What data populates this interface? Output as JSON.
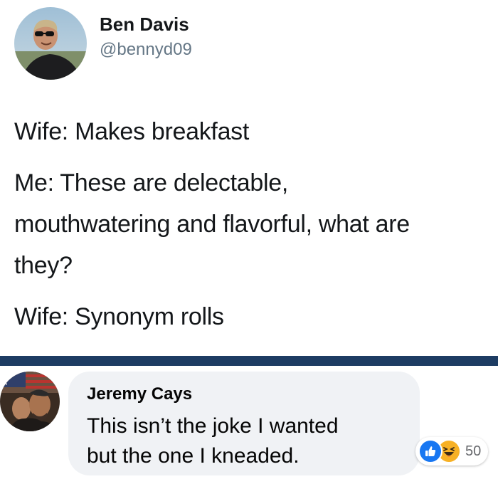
{
  "tweet": {
    "name": "Ben Davis",
    "handle": "@bennyd09",
    "lines": [
      "Wife: Makes breakfast",
      "Me: These are delectable,",
      "mouthwatering and flavorful, what are",
      "they?",
      "Wife: Synonym rolls"
    ]
  },
  "comment": {
    "author": "Jeremy Cays",
    "text_lines": [
      "This isn’t the joke I wanted",
      "but the one I kneaded."
    ],
    "reactions": {
      "icons": [
        "like-icon",
        "haha-icon"
      ],
      "count": "50"
    }
  },
  "colors": {
    "divider": "#1d3c63",
    "like_blue": "#1877f2",
    "haha_yellow": "#f7b125",
    "handle_gray": "#657786",
    "bubble_bg": "#f0f2f5"
  }
}
